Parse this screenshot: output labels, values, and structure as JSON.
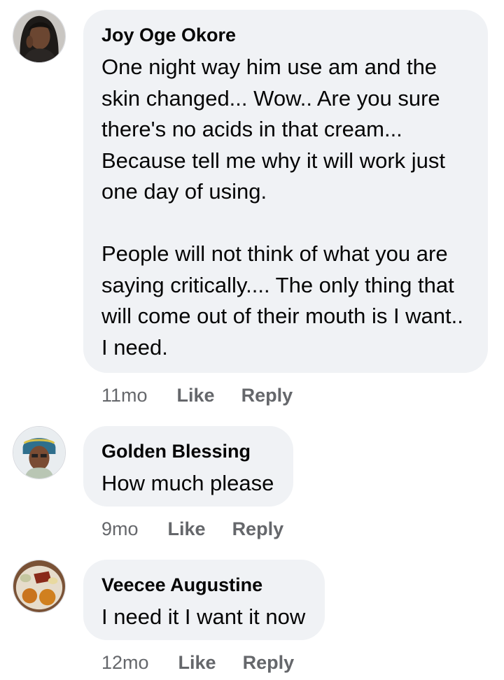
{
  "comments": [
    {
      "author": "Joy Oge Okore",
      "paragraphs": [
        "One night way him use am and the skin changed... Wow.. Are you sure there's no acids in that cream... Because tell me why it will work just one day of using.",
        "People will not think of what you are saying critically.... The only thing that will come out of their mouth is I want.. I need."
      ],
      "time": "11mo",
      "like_label": "Like",
      "reply_label": "Reply"
    },
    {
      "author": "Golden Blessing",
      "paragraphs": [
        "How much please"
      ],
      "time": "9mo",
      "like_label": "Like",
      "reply_label": "Reply"
    },
    {
      "author": "Veecee Augustine",
      "paragraphs": [
        "I need it I want it now"
      ],
      "time": "12mo",
      "like_label": "Like",
      "reply_label": "Reply"
    }
  ],
  "colors": {
    "bubble_bg": "#f0f2f5",
    "text": "#050505",
    "secondary": "#65676b"
  }
}
